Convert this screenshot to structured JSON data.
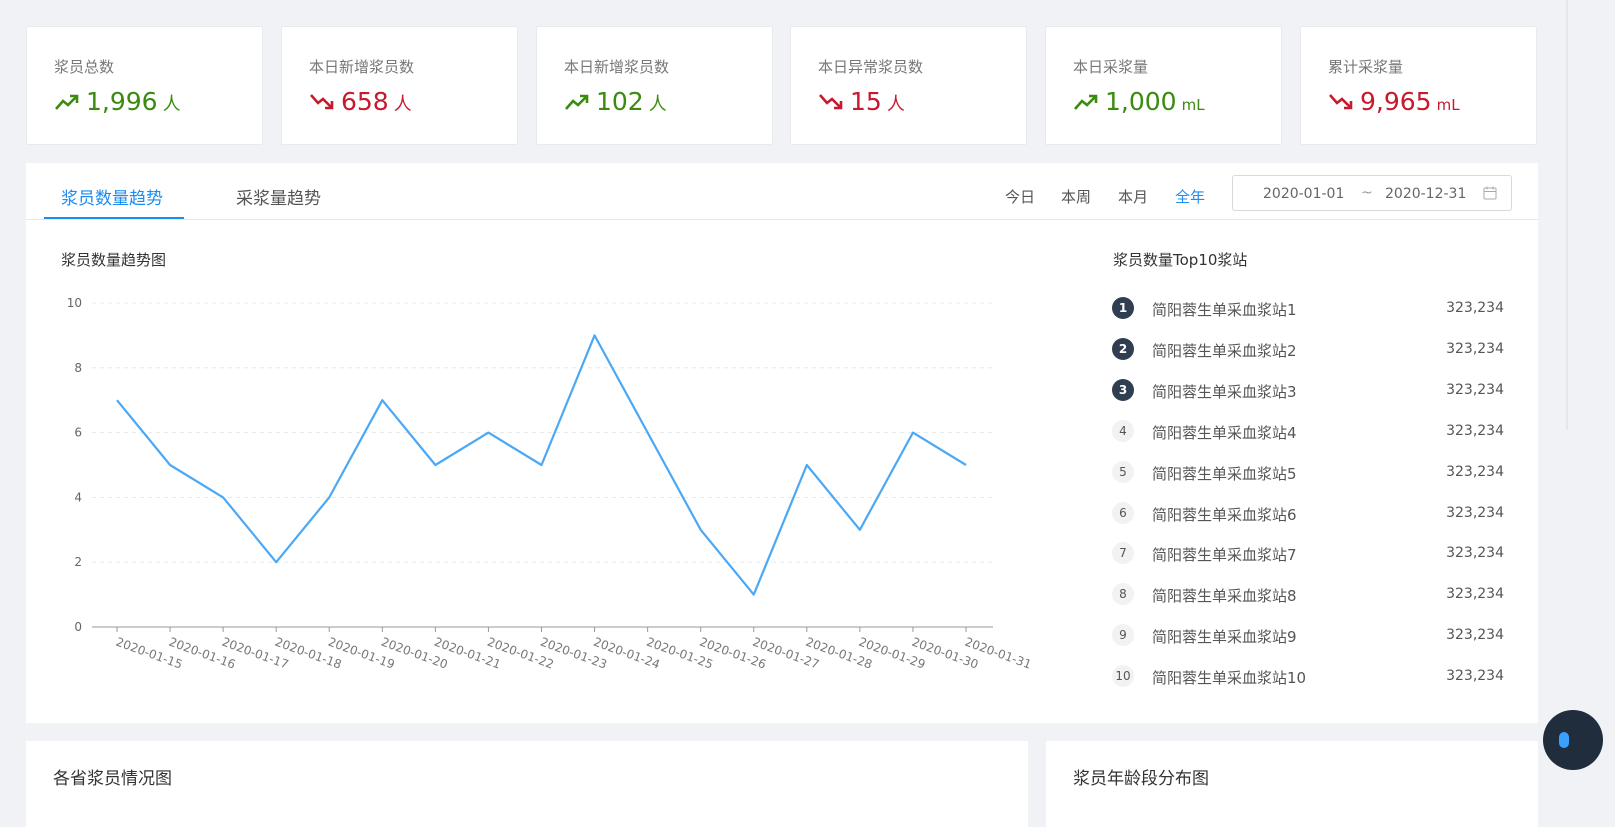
{
  "stats": [
    {
      "label": "浆员总数",
      "value": "1,996",
      "unit": "人",
      "trend": "up"
    },
    {
      "label": "本日新增浆员数",
      "value": "658",
      "unit": "人",
      "trend": "down"
    },
    {
      "label": "本日新增浆员数",
      "value": "102",
      "unit": "人",
      "trend": "up"
    },
    {
      "label": "本日异常浆员数",
      "value": "15",
      "unit": "人",
      "trend": "down"
    },
    {
      "label": "本日采浆量",
      "value": "1,000",
      "unit": "mL",
      "trend": "up"
    },
    {
      "label": "累计采浆量",
      "value": "9,965",
      "unit": "mL",
      "trend": "down"
    }
  ],
  "tabs": [
    {
      "label": "浆员数量趋势",
      "active": true
    },
    {
      "label": "采浆量趋势",
      "active": false
    }
  ],
  "periods": [
    {
      "label": "今日",
      "active": false
    },
    {
      "label": "本周",
      "active": false
    },
    {
      "label": "本月",
      "active": false
    },
    {
      "label": "全年",
      "active": true
    }
  ],
  "date_range": {
    "start": "2020-01-01",
    "separator": "~",
    "end": "2020-12-31"
  },
  "chart_title": "浆员数量趋势图",
  "chart_data": {
    "type": "line",
    "title": "",
    "xlabel": "",
    "ylabel": "",
    "x": [
      "2020-01-15",
      "2020-01-16",
      "2020-01-17",
      "2020-01-18",
      "2020-01-19",
      "2020-01-20",
      "2020-01-21",
      "2020-01-22",
      "2020-01-23",
      "2020-01-24",
      "2020-01-25",
      "2020-01-26",
      "2020-01-27",
      "2020-01-28",
      "2020-01-29",
      "2020-01-30",
      "2020-01-31"
    ],
    "series": [
      {
        "values": [
          7,
          5,
          4,
          2,
          4,
          7,
          5,
          6,
          5,
          9,
          6,
          3,
          1,
          5,
          3,
          6,
          5
        ]
      }
    ],
    "yticks": [
      "0",
      "2",
      "4",
      "6",
      "8",
      "10"
    ],
    "ylim": [
      0,
      10
    ],
    "grid": true,
    "line_color": "#4ba8f5"
  },
  "rank_title": "浆员数量Top10浆站",
  "rank_items": [
    {
      "rank": "1",
      "name": "简阳蓉生单采血浆站1",
      "value": "323,234"
    },
    {
      "rank": "2",
      "name": "简阳蓉生单采血浆站2",
      "value": "323,234"
    },
    {
      "rank": "3",
      "name": "简阳蓉生单采血浆站3",
      "value": "323,234"
    },
    {
      "rank": "4",
      "name": "简阳蓉生单采血浆站4",
      "value": "323,234"
    },
    {
      "rank": "5",
      "name": "简阳蓉生单采血浆站5",
      "value": "323,234"
    },
    {
      "rank": "6",
      "name": "简阳蓉生单采血浆站6",
      "value": "323,234"
    },
    {
      "rank": "7",
      "name": "简阳蓉生单采血浆站7",
      "value": "323,234"
    },
    {
      "rank": "8",
      "name": "简阳蓉生单采血浆站8",
      "value": "323,234"
    },
    {
      "rank": "9",
      "name": "简阳蓉生单采血浆站9",
      "value": "323,234"
    },
    {
      "rank": "10",
      "name": "简阳蓉生单采血浆站10",
      "value": "323,234"
    }
  ],
  "bottom_cards": [
    {
      "title": "各省浆员情况图"
    },
    {
      "title": "浆员年龄段分布图"
    }
  ],
  "colors": {
    "up": "#3a8b0e",
    "down": "#c8192e",
    "accent": "#1d8cf0"
  }
}
